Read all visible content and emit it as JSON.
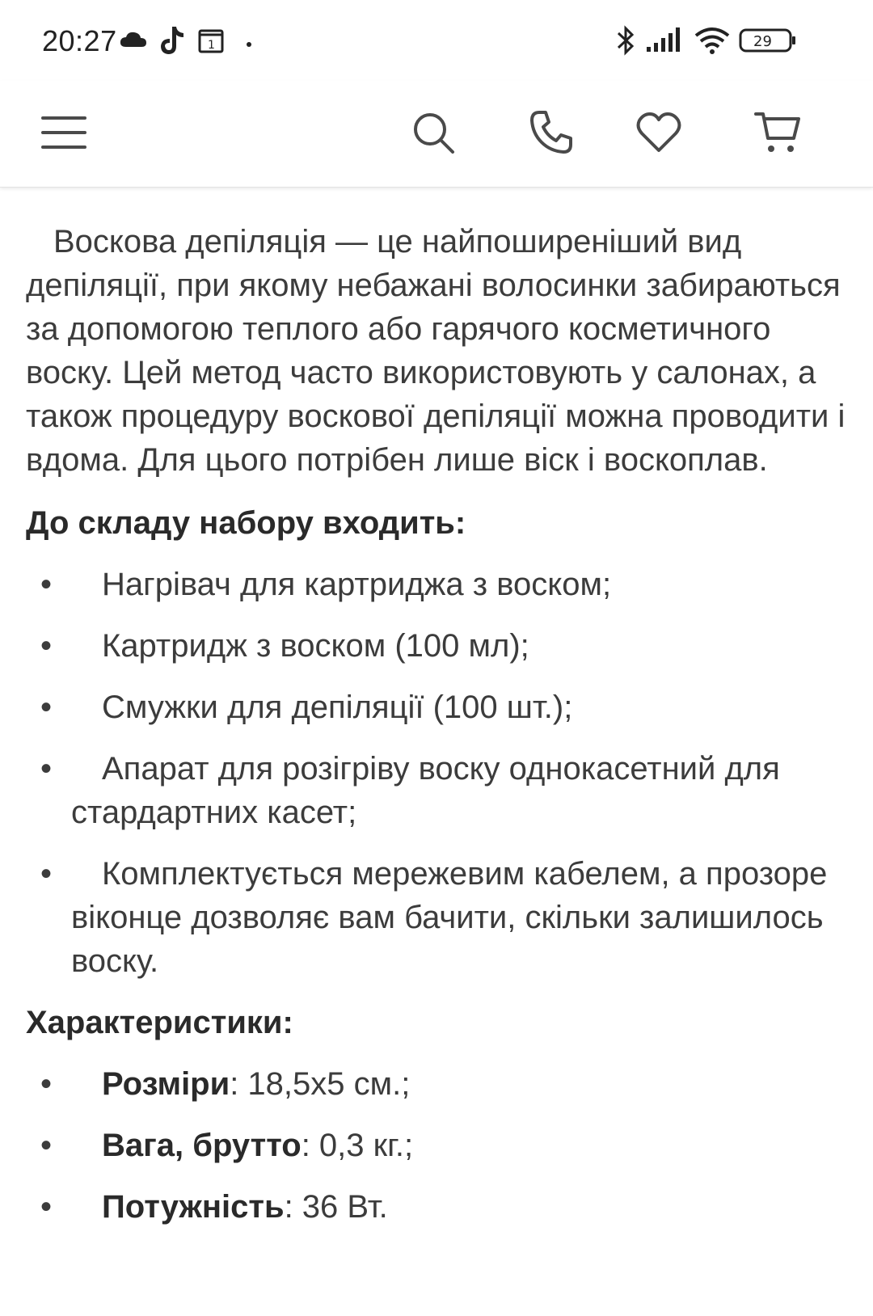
{
  "status_bar": {
    "time": "20:27",
    "calendar_day": "1",
    "battery_level": "29"
  },
  "header": {
    "icons": [
      "menu-icon",
      "search-icon",
      "phone-icon",
      "heart-icon",
      "cart-icon"
    ]
  },
  "content": {
    "intro": "Воскова депіляція — це найпоширеніший вид депіляції, при якому небажані волосинки забираються за допомогою теплого або гарячого косметичного воску. Цей метод часто використовують у салонах, а також процедуру воскової депіляції можна проводити і вдома. Для цього потрібен лише віск і воскоплав.",
    "kit_title": "До складу набору входить:",
    "kit_items": [
      "Нагрівач для картриджа з воском;",
      "Картридж з воском (100 мл);",
      "Смужки для депіляції (100 шт.);",
      "Апарат для розігріву воску однокасетний для стардартних касет;",
      "Комплектується мережевим кабелем, а прозоре віконце дозволяє вам бачити, скільки залишилось воску."
    ],
    "specs_title": "Характеристики:",
    "specs": [
      {
        "label": "Розміри",
        "value": ": 18,5х5 см.;"
      },
      {
        "label": "Вага, брутто",
        "value": ": 0,3 кг.;"
      },
      {
        "label": "Потужність",
        "value": ": 36 Вт."
      }
    ]
  },
  "colors": {
    "text": "#3c3c3c",
    "icon": "#4a4a4a",
    "divider": "#e2e2e2"
  }
}
